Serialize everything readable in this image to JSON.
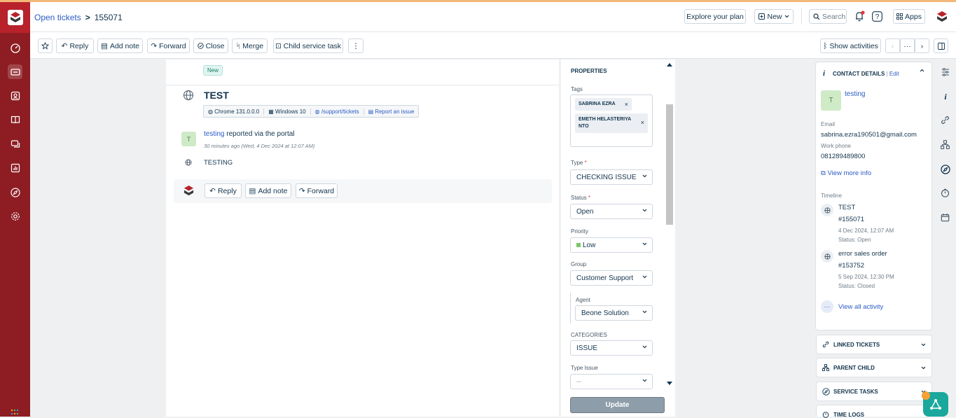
{
  "header": {
    "breadcrumb_link": "Open tickets",
    "breadcrumb_sep": ">",
    "ticket_id": "155071",
    "explore": "Explore your plan",
    "new_label": "New",
    "search_placeholder": "Search",
    "apps": "Apps"
  },
  "toolbar": {
    "reply": "Reply",
    "add_note": "Add note",
    "forward": "Forward",
    "close": "Close",
    "merge": "Merge",
    "child_task": "Child service task",
    "more": "⋮",
    "show_activities": "Show activities",
    "nav_more": "···"
  },
  "ticket": {
    "badge": "New",
    "subject": "TEST",
    "meta": {
      "browser": "Chrome 131.0.0.0",
      "os": "Windows 10",
      "path": "/support/tickets",
      "report": "Report an issue"
    },
    "requester_initial": "T",
    "requester": "testing",
    "via": "reported via the portal",
    "time": "30 minutes ago (Wed, 4 Dec 2024 at 12:07 AM)",
    "body": "TESTING",
    "reply": "Reply",
    "add_note": "Add note",
    "forward": "Forward"
  },
  "properties": {
    "title": "PROPERTIES",
    "tags_label": "Tags",
    "tags": [
      "SABRINA EZRA",
      "EMETH HELASTERIYA NTO"
    ],
    "type_label": "Type",
    "type_value": "CHECKING ISSUE",
    "status_label": "Status",
    "status_value": "Open",
    "priority_label": "Priority",
    "priority_value": "Low",
    "priority_color": "#7cc46a",
    "group_label": "Group",
    "group_value": "Customer Support",
    "agent_label": "Agent",
    "agent_value": "Beone Solution",
    "categories_label": "CATEGORIES",
    "categories_value": "ISSUE",
    "type_issue_label": "Type Issue",
    "type_issue_value": "--",
    "required_mark": "*",
    "update": "Update"
  },
  "contact": {
    "title": "CONTACT DETAILS",
    "sep": "|",
    "edit": "Edit",
    "initial": "T",
    "name": "testing",
    "email_label": "Email",
    "email": "sabrina.ezra190501@gmail.com",
    "phone_label": "Work phone",
    "phone": "081289489800",
    "view_more": "View more info",
    "timeline_label": "Timeline",
    "timeline": [
      {
        "title": "TEST",
        "id": "#155071",
        "date": "4 Dec 2024, 12:07 AM",
        "status": "Status: Open"
      },
      {
        "title": "error sales order",
        "id": "#153752",
        "date": "5 Sep 2024, 12:30 PM",
        "status": "Status: Closed"
      }
    ],
    "view_all": "View all activity"
  },
  "sections": {
    "linked": "LINKED TICKETS",
    "parent": "PARENT CHILD",
    "service": "SERVICE TASKS",
    "time": "TIME LOGS"
  },
  "colors": {
    "rail": "#8d1d22",
    "accent": "#2c5cc5",
    "update_btn": "#8d9da9"
  }
}
